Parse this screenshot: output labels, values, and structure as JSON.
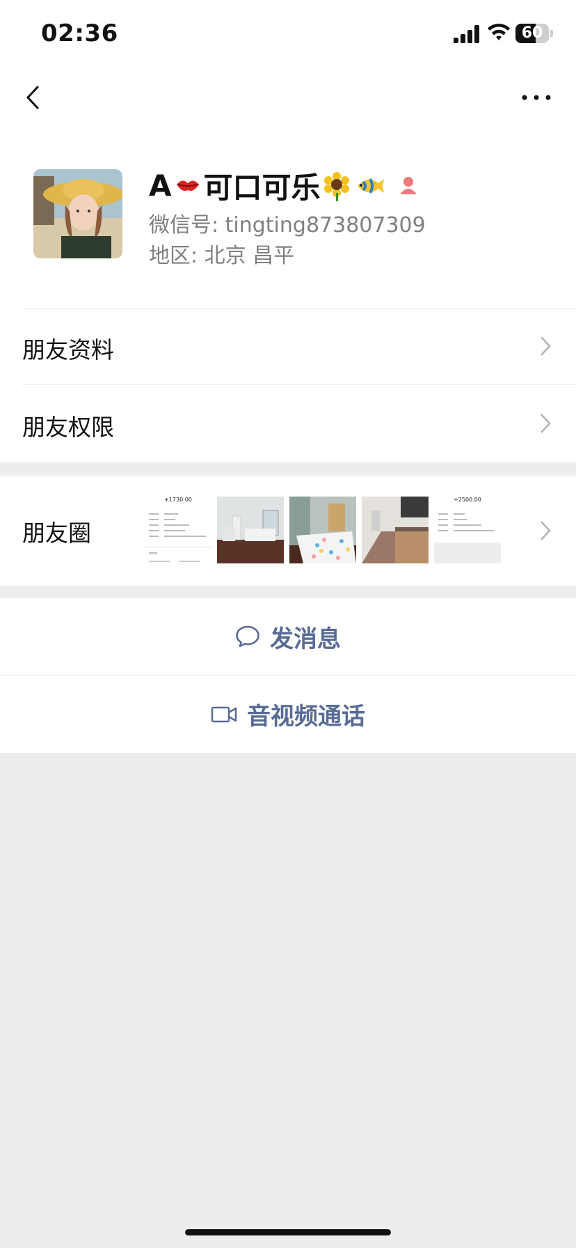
{
  "status_bar": {
    "time": "02:36",
    "battery": "60"
  },
  "profile": {
    "name_prefix": "A",
    "name_main": "可口可乐",
    "wechat_id": "微信号: tingting873807309",
    "region": "地区: 北京 昌平"
  },
  "menu": {
    "friend_info": "朋友资料",
    "friend_permissions": "朋友权限",
    "moments": "朋友圈"
  },
  "moments_thumbs": [
    {
      "type": "listing",
      "price": "+1730.00"
    },
    {
      "type": "photo",
      "scene": "bedroom-window"
    },
    {
      "type": "photo",
      "scene": "bed-floral"
    },
    {
      "type": "photo",
      "scene": "kitchen"
    },
    {
      "type": "listing",
      "price": "+2500.00"
    }
  ],
  "actions": {
    "send_message": "发消息",
    "video_call": "音视频通话"
  },
  "colors": {
    "link_blue": "#576b95",
    "background": "#ededed",
    "gender_female": "#f07a7a"
  }
}
